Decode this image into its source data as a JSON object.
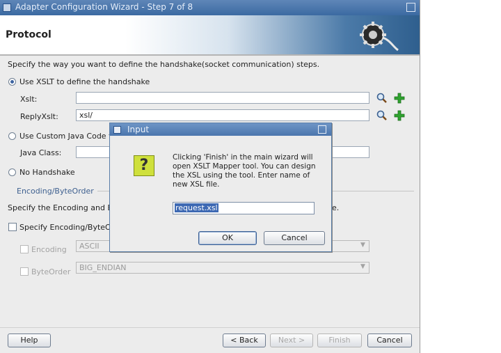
{
  "window": {
    "title": "Adapter Configuration Wizard - Step 7 of 8"
  },
  "header": {
    "title": "Protocol"
  },
  "main": {
    "instruction": "Specify the way you want to define the handshake(socket communication) steps.",
    "use_xslt_label": "Use XSLT to define the handshake",
    "xslt_label": "Xslt:",
    "xslt_value": "",
    "reply_xslt_label": "ReplyXslt:",
    "reply_xslt_value": "xsl/",
    "use_custom_java_label": "Use Custom Java Code t",
    "java_class_label": "Java Class:",
    "java_class_value": "",
    "no_handshake_label": "No Handshake",
    "encoding_section_title": "Encoding/ByteOrder",
    "encoding_instruction_left": "Specify the Encoding and By",
    "encoding_instruction_right": "e.",
    "specify_encoding_label": "Specify Encoding/ByteO",
    "encoding_label": "Encoding",
    "encoding_value": "ASCII",
    "byteorder_label": "ByteOrder",
    "byteorder_value": "BIG_ENDIAN"
  },
  "footer": {
    "help": "Help",
    "back": "< Back",
    "next": "Next >",
    "finish": "Finish",
    "cancel": "Cancel"
  },
  "dialog": {
    "title": "Input",
    "icon": "?",
    "message": "Clicking 'Finish' in the main wizard will open XSLT Mapper tool. You can design the XSL using the tool. Enter name of new XSL file.",
    "input_value": "request.xsl",
    "ok": "OK",
    "cancel": "Cancel"
  },
  "colors": {
    "titlebar": "#3b6aa2",
    "add_icon": "#2fa32f",
    "question_icon": "#cfe03c"
  }
}
